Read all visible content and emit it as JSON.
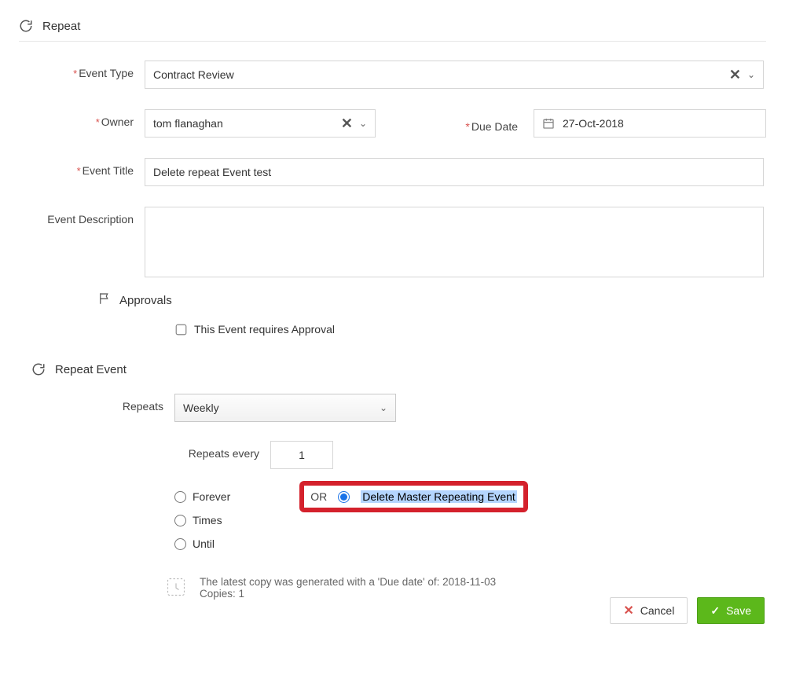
{
  "header": {
    "title": "Repeat"
  },
  "form": {
    "event_type": {
      "label": "Event Type",
      "value": "Contract Review"
    },
    "owner": {
      "label": "Owner",
      "value": "tom flanaghan"
    },
    "due_date": {
      "label": "Due Date",
      "value": "27-Oct-2018"
    },
    "event_title": {
      "label": "Event Title",
      "value": "Delete repeat Event test"
    },
    "event_description": {
      "label": "Event Description",
      "value": ""
    }
  },
  "approvals": {
    "heading": "Approvals",
    "checkbox_label": "This Event requires Approval",
    "checked": false
  },
  "repeat": {
    "heading": "Repeat Event",
    "repeats_label": "Repeats",
    "repeats_value": "Weekly",
    "repeats_every_label": "Repeats every",
    "repeats_every_value": "1",
    "end_options": {
      "forever": "Forever",
      "times": "Times",
      "until": "Until"
    },
    "or_label": "OR",
    "delete_master_label": "Delete Master Repeating Event",
    "delete_master_selected": true
  },
  "note": {
    "line1": "The latest copy was generated with a 'Due date' of: 2018-11-03",
    "line2": "Copies: 1"
  },
  "actions": {
    "cancel": "Cancel",
    "save": "Save"
  }
}
